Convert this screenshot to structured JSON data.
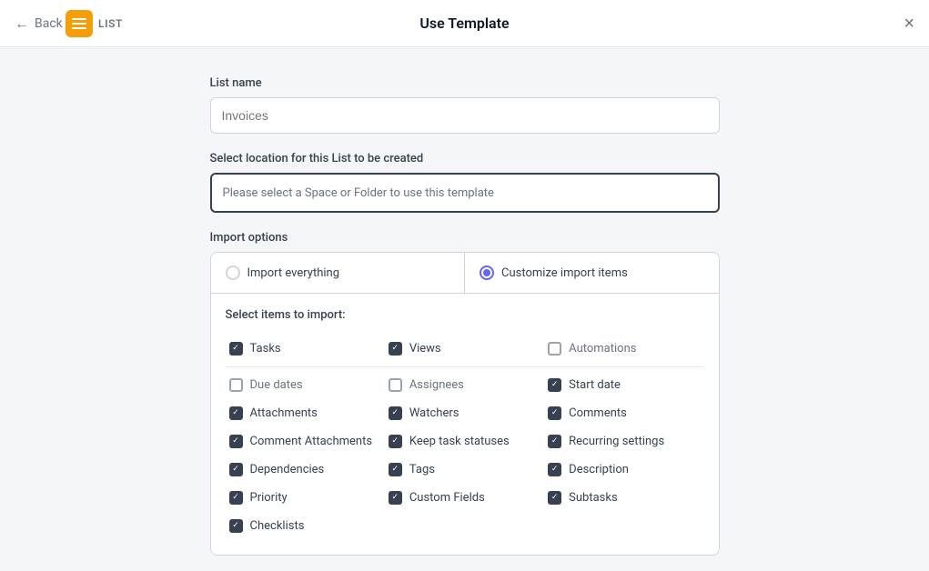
{
  "header": {
    "back_label": "Back",
    "list_label": "LIST",
    "title": "Use Template",
    "close_label": "×"
  },
  "form": {
    "list_name_label": "List name",
    "list_name_placeholder": "Invoices",
    "location_label": "Select location for this List to be created",
    "location_placeholder": "Please select a Space or Folder to use this template",
    "import_options_label": "Import options"
  },
  "radio_options": [
    {
      "id": "import-everything",
      "label": "Import everything",
      "selected": false
    },
    {
      "id": "customize-import",
      "label": "Customize import items",
      "selected": true
    }
  ],
  "select_items_label": "Select items to import:",
  "checkboxes": [
    {
      "col": 0,
      "label": "Tasks",
      "checked": true,
      "light": false
    },
    {
      "col": 1,
      "label": "Views",
      "checked": true,
      "light": false
    },
    {
      "col": 2,
      "label": "Automations",
      "checked": false,
      "light": true
    },
    {
      "divider": true
    },
    {
      "col": 0,
      "label": "Due dates",
      "checked": false,
      "light": true
    },
    {
      "col": 1,
      "label": "Assignees",
      "checked": false,
      "light": true
    },
    {
      "col": 2,
      "label": "Start date",
      "checked": true,
      "light": false
    },
    {
      "col": 0,
      "label": "Attachments",
      "checked": true,
      "light": false
    },
    {
      "col": 1,
      "label": "Watchers",
      "checked": true,
      "light": false
    },
    {
      "col": 2,
      "label": "Comments",
      "checked": true,
      "light": false
    },
    {
      "col": 0,
      "label": "Comment Attachments",
      "checked": true,
      "light": false
    },
    {
      "col": 1,
      "label": "Keep task statuses",
      "checked": true,
      "light": false
    },
    {
      "col": 2,
      "label": "Recurring settings",
      "checked": true,
      "light": false
    },
    {
      "col": 0,
      "label": "Dependencies",
      "checked": true,
      "light": false
    },
    {
      "col": 1,
      "label": "Tags",
      "checked": true,
      "light": false
    },
    {
      "col": 2,
      "label": "Description",
      "checked": true,
      "light": false
    },
    {
      "col": 0,
      "label": "Priority",
      "checked": true,
      "light": false
    },
    {
      "col": 1,
      "label": "Custom Fields",
      "checked": true,
      "light": false
    },
    {
      "col": 2,
      "label": "Subtasks",
      "checked": true,
      "light": false
    },
    {
      "col": 0,
      "label": "Checklists",
      "checked": true,
      "light": false
    }
  ]
}
